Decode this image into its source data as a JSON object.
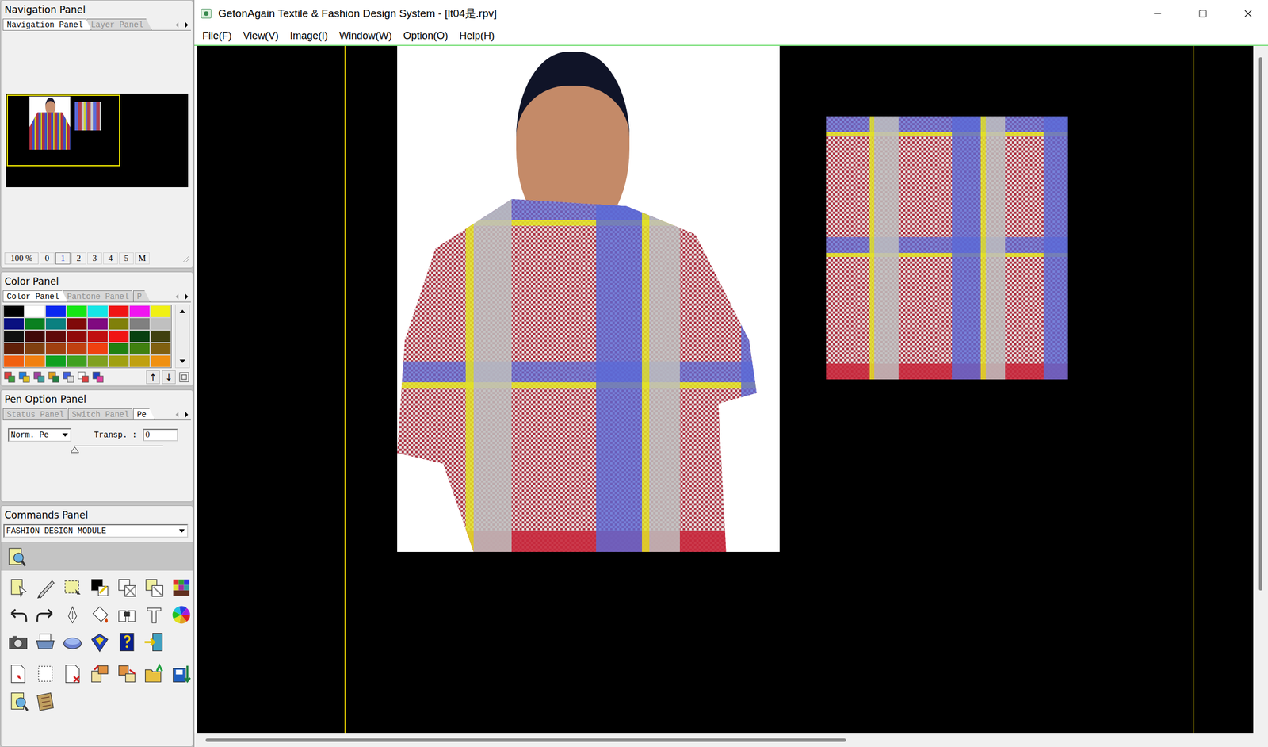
{
  "window": {
    "title": "GetonAgain Textile & Fashion Design System - [lt04是.rpv]"
  },
  "menu": [
    "File(F)",
    "View(V)",
    "Image(I)",
    "Window(W)",
    "Option(O)",
    "Help(H)"
  ],
  "navigation_panel": {
    "title": "Navigation Panel",
    "tabs": [
      {
        "label": "Navigation Panel",
        "selected": true
      },
      {
        "label": "Layer Panel",
        "selected": false
      }
    ],
    "zoom": "100 %",
    "zoom_levels": [
      {
        "label": "0",
        "selected": false
      },
      {
        "label": "1",
        "selected": true
      },
      {
        "label": "2",
        "selected": false
      },
      {
        "label": "3",
        "selected": false
      },
      {
        "label": "4",
        "selected": false
      },
      {
        "label": "5",
        "selected": false
      },
      {
        "label": "M",
        "selected": false
      }
    ]
  },
  "color_panel": {
    "title": "Color Panel",
    "tabs": [
      {
        "label": "Color Panel",
        "selected": true
      },
      {
        "label": "Pantone Panel",
        "selected": false
      },
      {
        "label": "P",
        "selected": false
      }
    ],
    "swatches": [
      {
        "color": "#000000"
      },
      {
        "color": "#ffffff"
      },
      {
        "color": "#0a28f0"
      },
      {
        "color": "#14e614"
      },
      {
        "color": "#14e6e6"
      },
      {
        "color": "#f01414"
      },
      {
        "color": "#f014f0"
      },
      {
        "color": "#f0f014"
      },
      {
        "color": "#0a1080"
      },
      {
        "color": "#0a8020"
      },
      {
        "color": "#0a8080"
      },
      {
        "color": "#800a0a"
      },
      {
        "color": "#800a80"
      },
      {
        "color": "#80800a"
      },
      {
        "color": "#808080"
      },
      {
        "color": "#c0c0c0"
      },
      {
        "color": "#101010"
      },
      {
        "color": "#400808"
      },
      {
        "color": "#600a0a"
      },
      {
        "color": "#900a0a"
      },
      {
        "color": "#c01010"
      },
      {
        "color": "#f01414"
      },
      {
        "color": "#084010"
      },
      {
        "color": "#404010"
      },
      {
        "color": "#602008"
      },
      {
        "color": "#804010"
      },
      {
        "color": "#a04010"
      },
      {
        "color": "#c04010"
      },
      {
        "color": "#f04010"
      },
      {
        "color": "#208010"
      },
      {
        "color": "#408010"
      },
      {
        "color": "#806010"
      },
      {
        "color": "#f06010"
      },
      {
        "color": "#f08010"
      },
      {
        "color": "#10a020"
      },
      {
        "color": "#40a020"
      },
      {
        "color": "#80a020"
      },
      {
        "color": "#a0a010"
      },
      {
        "color": "#c0a010"
      },
      {
        "color": "#f09010"
      }
    ],
    "arrows": [
      "↑",
      "↓"
    ]
  },
  "pen_option_panel": {
    "title": "Pen Option Panel",
    "tabs": [
      {
        "label": "Status Panel",
        "selected": false
      },
      {
        "label": "Switch Panel",
        "selected": false
      },
      {
        "label": "Pe",
        "selected": true
      }
    ],
    "mode": "Norm. Pe",
    "transparency_label": "Transp. :",
    "transparency_value": "0",
    "transparency_level": 0
  },
  "commands_panel": {
    "title": "Commands Panel",
    "module": "FASHION DESIGN MODULE"
  }
}
